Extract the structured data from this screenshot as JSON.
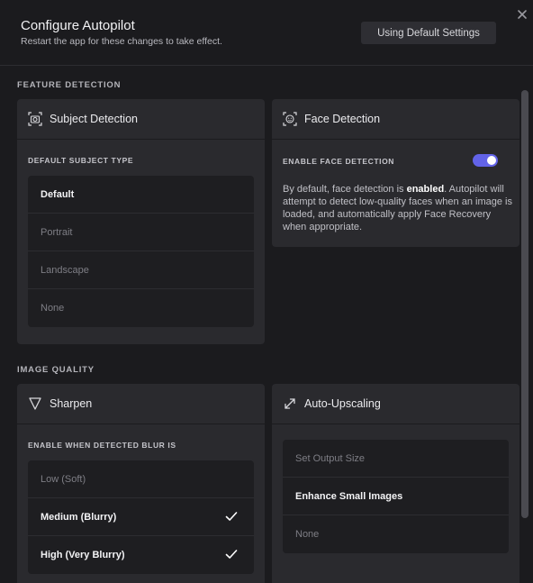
{
  "header": {
    "title": "Configure Autopilot",
    "subtitle": "Restart the app for these changes to take effect.",
    "default_button": "Using Default Settings"
  },
  "feature_detection": {
    "label": "FEATURE DETECTION",
    "subject": {
      "title": "Subject Detection",
      "icon": "camera-focus-icon",
      "sub_label": "DEFAULT SUBJECT TYPE",
      "options": [
        "Default",
        "Portrait",
        "Landscape",
        "None"
      ],
      "selected": "Default"
    },
    "face": {
      "title": "Face Detection",
      "icon": "face-scan-icon",
      "toggle_label": "ENABLE FACE DETECTION",
      "enabled": true,
      "desc_before": "By default, face detection is ",
      "desc_bold": "enabled",
      "desc_after": ". Autopilot will attempt to detect low-quality faces when an image is loaded, and automatically apply Face Recovery when appropriate."
    }
  },
  "image_quality": {
    "label": "IMAGE QUALITY",
    "sharpen": {
      "title": "Sharpen",
      "icon": "triangle-down-icon",
      "sub_label": "ENABLE WHEN DETECTED BLUR IS",
      "options": [
        "Low (Soft)",
        "Medium (Blurry)",
        "High (Very Blurry)"
      ],
      "checked": [
        false,
        true,
        true
      ]
    },
    "upscaling": {
      "title": "Auto-Upscaling",
      "icon": "expand-arrows-icon",
      "options": [
        "Set Output Size",
        "Enhance Small Images",
        "None"
      ],
      "selected": "Enhance Small Images"
    }
  },
  "colors": {
    "accent": "#6263e8",
    "background": "#1b1b1e",
    "card": "#2a2a2e"
  }
}
